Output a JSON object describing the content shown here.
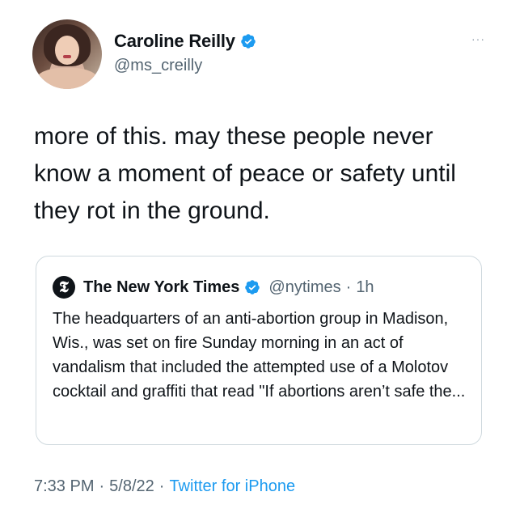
{
  "author": {
    "display_name": "Caroline Reilly",
    "handle": "@ms_creilly",
    "verified": true,
    "avatar_icon": "profile-photo"
  },
  "more_menu": {
    "label": "···",
    "icon": "more-horizontal-icon"
  },
  "tweet": {
    "text": "more of this. may these people never know a moment of peace or safety until they rot in the ground."
  },
  "quoted_tweet": {
    "logo_icon": "nyt-logo-icon",
    "logo_glyph": "𝕿",
    "display_name": "The New York Times",
    "verified": true,
    "handle": "@nytimes",
    "separator": "·",
    "time": "1h",
    "text": "The headquarters of an anti-abortion group in Madison, Wis., was set on fire Sunday morning in an act of vandalism that included the attempted use of a Molotov cocktail and graffiti that read \"If abortions aren’t safe the..."
  },
  "meta": {
    "time": "7:33 PM",
    "separator_1": "·",
    "date": "5/8/22",
    "separator_2": "·",
    "source": "Twitter for iPhone"
  },
  "colors": {
    "verified_blue": "#1d9bf0",
    "secondary_text": "#536471",
    "primary_text": "#0f1419",
    "border": "#cfd9de"
  }
}
